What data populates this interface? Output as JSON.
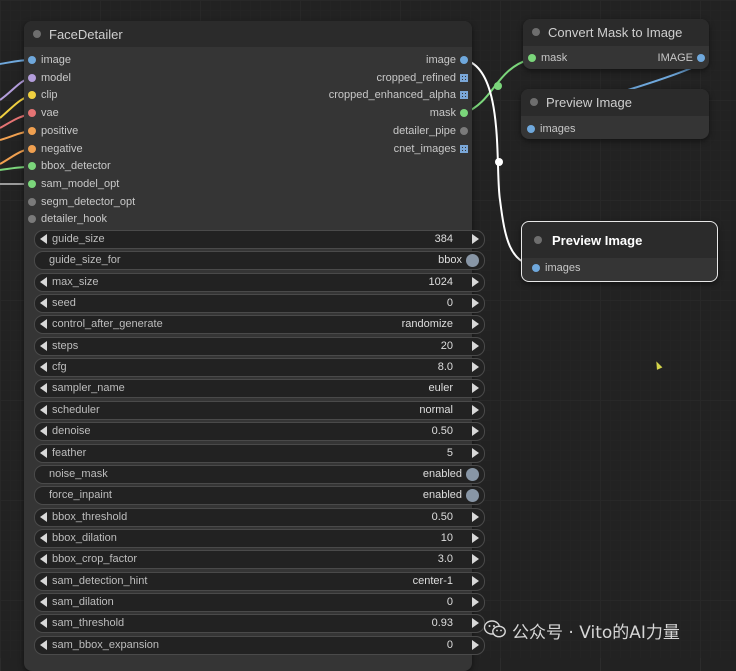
{
  "colors": {
    "image": "#6fa8dc",
    "model": "#b39ddb",
    "clip": "#f0d040",
    "vae": "#e57373",
    "conditioning": "#f0a050",
    "detector": "#7bd67b",
    "generic": "#7a7a7a",
    "mask": "#7bd67b",
    "link_white": "#ffffff"
  },
  "face_detailer": {
    "title": "FaceDetailer",
    "inputs": [
      {
        "label": "image",
        "color": "image"
      },
      {
        "label": "model",
        "color": "model"
      },
      {
        "label": "clip",
        "color": "clip"
      },
      {
        "label": "vae",
        "color": "vae"
      },
      {
        "label": "positive",
        "color": "conditioning"
      },
      {
        "label": "negative",
        "color": "conditioning"
      },
      {
        "label": "bbox_detector",
        "color": "detector"
      },
      {
        "label": "sam_model_opt",
        "color": "detector"
      },
      {
        "label": "segm_detector_opt",
        "color": "generic"
      },
      {
        "label": "detailer_hook",
        "color": "generic"
      }
    ],
    "outputs": [
      {
        "label": "image",
        "icon": "dot",
        "color": "image"
      },
      {
        "label": "cropped_refined",
        "icon": "grid",
        "color": "image"
      },
      {
        "label": "cropped_enhanced_alpha",
        "icon": "grid",
        "color": "image"
      },
      {
        "label": "mask",
        "icon": "dot",
        "color": "mask"
      },
      {
        "label": "detailer_pipe",
        "icon": "dot",
        "color": "generic"
      },
      {
        "label": "cnet_images",
        "icon": "grid",
        "color": "image"
      }
    ],
    "widgets": [
      {
        "label": "guide_size",
        "value": "384",
        "kind": "number"
      },
      {
        "label": "guide_size_for",
        "value": "bbox",
        "kind": "toggle"
      },
      {
        "label": "max_size",
        "value": "1024",
        "kind": "number"
      },
      {
        "label": "seed",
        "value": "0",
        "kind": "number"
      },
      {
        "label": "control_after_generate",
        "value": "randomize",
        "kind": "combo"
      },
      {
        "label": "steps",
        "value": "20",
        "kind": "number"
      },
      {
        "label": "cfg",
        "value": "8.0",
        "kind": "number"
      },
      {
        "label": "sampler_name",
        "value": "euler",
        "kind": "combo"
      },
      {
        "label": "scheduler",
        "value": "normal",
        "kind": "combo"
      },
      {
        "label": "denoise",
        "value": "0.50",
        "kind": "number"
      },
      {
        "label": "feather",
        "value": "5",
        "kind": "number"
      },
      {
        "label": "noise_mask",
        "value": "enabled",
        "kind": "toggle"
      },
      {
        "label": "force_inpaint",
        "value": "enabled",
        "kind": "toggle"
      },
      {
        "label": "bbox_threshold",
        "value": "0.50",
        "kind": "number"
      },
      {
        "label": "bbox_dilation",
        "value": "10",
        "kind": "number"
      },
      {
        "label": "bbox_crop_factor",
        "value": "3.0",
        "kind": "number"
      },
      {
        "label": "sam_detection_hint",
        "value": "center-1",
        "kind": "combo"
      },
      {
        "label": "sam_dilation",
        "value": "0",
        "kind": "number"
      },
      {
        "label": "sam_threshold",
        "value": "0.93",
        "kind": "number"
      },
      {
        "label": "sam_bbox_expansion",
        "value": "0",
        "kind": "number"
      }
    ]
  },
  "convert_mask": {
    "title": "Convert Mask to Image",
    "input_label": "mask",
    "output_label": "IMAGE"
  },
  "preview_image_1": {
    "title": "Preview Image",
    "input_label": "images"
  },
  "preview_image_2": {
    "title": "Preview Image",
    "input_label": "images"
  },
  "watermark": {
    "text": "公众号 · Vito的AI力量"
  }
}
